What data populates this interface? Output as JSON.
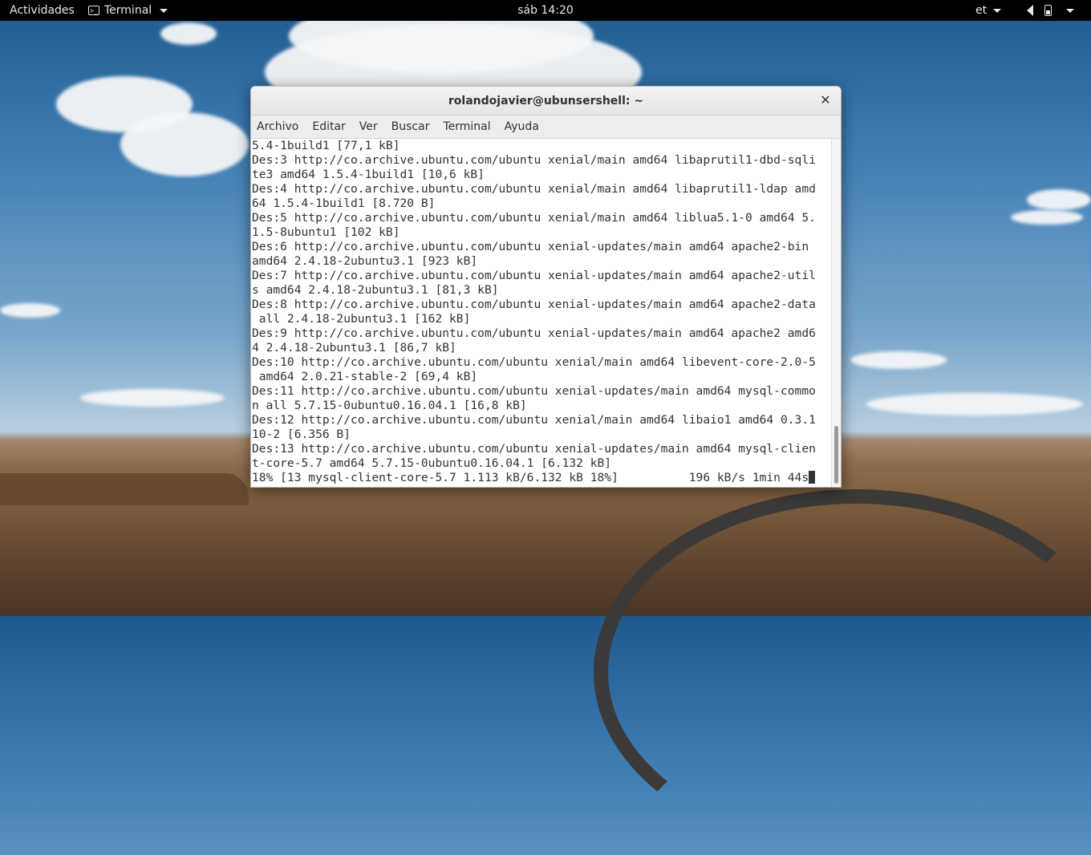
{
  "topbar": {
    "activities": "Actividades",
    "app_name": "Terminal",
    "clock": "sáb 14:20",
    "keyboard_layout": "et",
    "icons": [
      "terminal-icon",
      "speaker-icon",
      "battery-icon",
      "power-menu-caret"
    ]
  },
  "window": {
    "title": "rolandojavier@ubunsershell: ~",
    "menu": [
      "Archivo",
      "Editar",
      "Ver",
      "Buscar",
      "Terminal",
      "Ayuda"
    ],
    "terminal_lines": [
      "5.4-1build1 [77,1 kB]",
      "Des:3 http://co.archive.ubuntu.com/ubuntu xenial/main amd64 libaprutil1-dbd-sqli",
      "te3 amd64 1.5.4-1build1 [10,6 kB]",
      "Des:4 http://co.archive.ubuntu.com/ubuntu xenial/main amd64 libaprutil1-ldap amd",
      "64 1.5.4-1build1 [8.720 B]",
      "Des:5 http://co.archive.ubuntu.com/ubuntu xenial/main amd64 liblua5.1-0 amd64 5.",
      "1.5-8ubuntu1 [102 kB]",
      "Des:6 http://co.archive.ubuntu.com/ubuntu xenial-updates/main amd64 apache2-bin ",
      "amd64 2.4.18-2ubuntu3.1 [923 kB]",
      "Des:7 http://co.archive.ubuntu.com/ubuntu xenial-updates/main amd64 apache2-util",
      "s amd64 2.4.18-2ubuntu3.1 [81,3 kB]",
      "Des:8 http://co.archive.ubuntu.com/ubuntu xenial-updates/main amd64 apache2-data",
      " all 2.4.18-2ubuntu3.1 [162 kB]",
      "Des:9 http://co.archive.ubuntu.com/ubuntu xenial-updates/main amd64 apache2 amd6",
      "4 2.4.18-2ubuntu3.1 [86,7 kB]",
      "Des:10 http://co.archive.ubuntu.com/ubuntu xenial/main amd64 libevent-core-2.0-5",
      " amd64 2.0.21-stable-2 [69,4 kB]",
      "Des:11 http://co.archive.ubuntu.com/ubuntu xenial-updates/main amd64 mysql-commo",
      "n all 5.7.15-0ubuntu0.16.04.1 [16,8 kB]",
      "Des:12 http://co.archive.ubuntu.com/ubuntu xenial/main amd64 libaio1 amd64 0.3.1",
      "10-2 [6.356 B]",
      "Des:13 http://co.archive.ubuntu.com/ubuntu xenial-updates/main amd64 mysql-clien",
      "t-core-5.7 amd64 5.7.15-0ubuntu0.16.04.1 [6.132 kB]"
    ],
    "progress_line": "18% [13 mysql-client-core-5.7 1.113 kB/6.132 kB 18%]          196 kB/s 1min 44s"
  }
}
